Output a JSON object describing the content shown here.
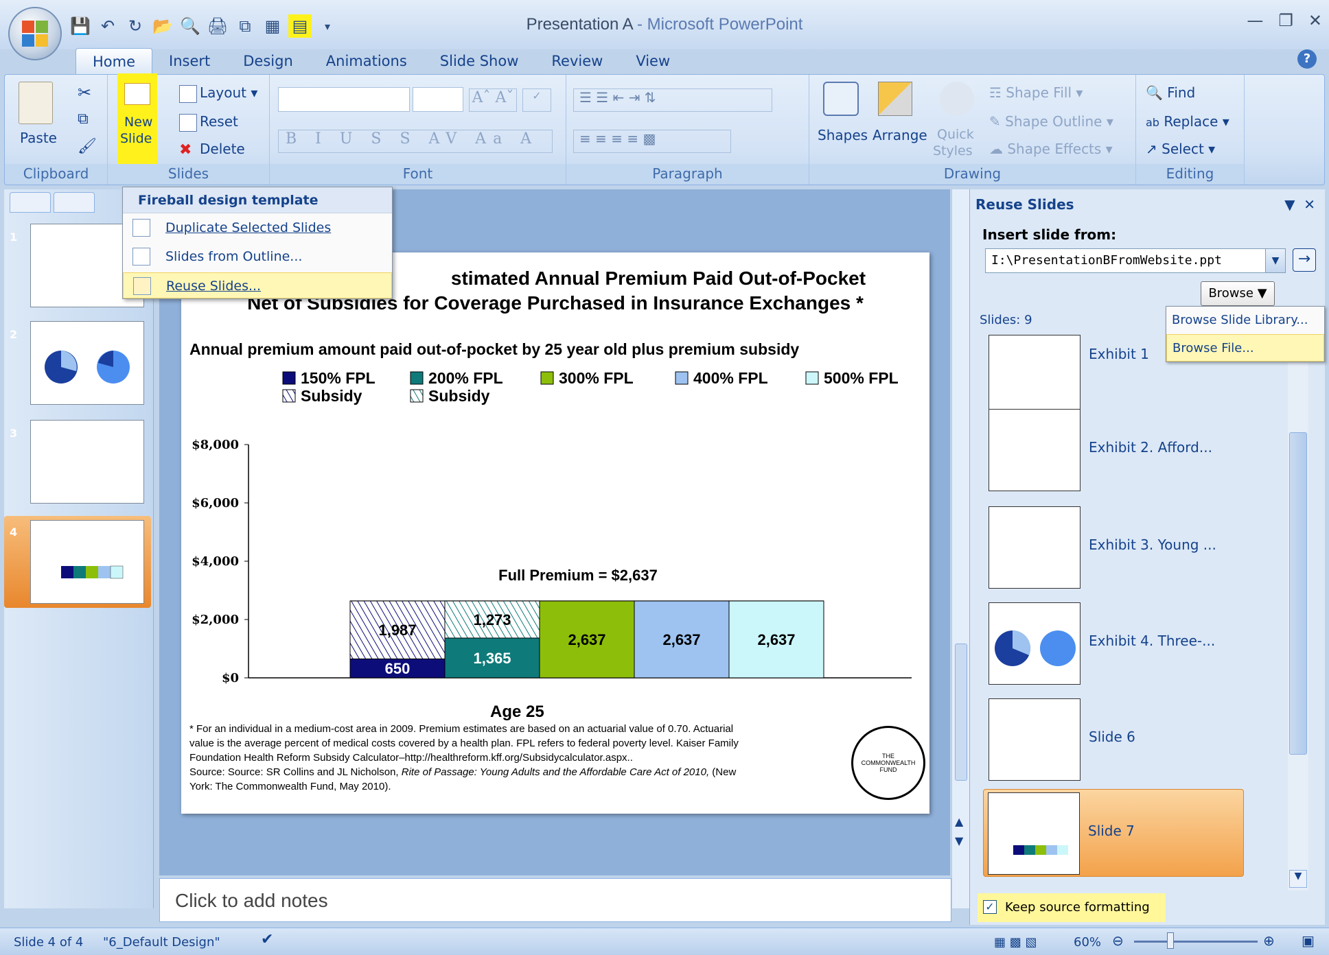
{
  "window": {
    "title": "Presentation A",
    "app": " - Microsoft PowerPoint"
  },
  "tabs": [
    "Home",
    "Insert",
    "Design",
    "Animations",
    "Slide Show",
    "Review",
    "View"
  ],
  "ribbon": {
    "clipboard": {
      "label": "Clipboard",
      "paste": "Paste"
    },
    "slides": {
      "label": "Slides",
      "new_slide_1": "New",
      "new_slide_2": "Slide",
      "layout": "Layout",
      "reset": "Reset",
      "delete": "Delete"
    },
    "font": {
      "label": "Font"
    },
    "paragraph": {
      "label": "Paragraph"
    },
    "drawing": {
      "label": "Drawing",
      "shapes": "Shapes",
      "arrange": "Arrange",
      "quick_styles_1": "Quick",
      "quick_styles_2": "Styles",
      "shape_fill": "Shape Fill",
      "shape_outline": "Shape Outline",
      "shape_effects": "Shape Effects"
    },
    "editing": {
      "label": "Editing",
      "find": "Find",
      "replace": "Replace",
      "select": "Select"
    }
  },
  "new_slide_menu": {
    "header": "Fireball design template",
    "items": [
      "Duplicate Selected Slides",
      "Slides from Outline...",
      "Reuse Slides..."
    ]
  },
  "slide_numbers": [
    "1",
    "2",
    "3",
    "4"
  ],
  "slide": {
    "title_line1": "stimated Annual Premium Paid Out-of-Pocket",
    "title_line2": "Net of Subsidies for Coverage Purchased in Insurance Exchanges",
    "title_star": " *",
    "subtitle": "Annual premium amount paid out-of-pocket by 25 year old plus premium subsidy",
    "full_premium": "Full Premium = $2,637",
    "footnote_1": "* For an individual in a medium-cost area in 2009. Premium estimates are based on an actuarial value of 0.70. Actuarial",
    "footnote_2": "value is the average percent of medical costs covered by a health plan. FPL refers to federal poverty level. Kaiser Family",
    "footnote_3": "Foundation Health Reform Subsidy Calculator–http://healthreform.kff.org/Subsidycalculator.aspx..",
    "footnote_4a": "Source: Source: SR Collins and JL Nicholson, ",
    "footnote_4b": "Rite of Passage: Young Adults and the Affordable Care Act of 2010,",
    "footnote_4c": " (New",
    "footnote_5": "York: The Commonwealth Fund, May 2010).",
    "logo_text": "THE COMMONWEALTH FUND"
  },
  "chart_data": {
    "type": "bar",
    "stacked": true,
    "title": "Annual premium amount paid out-of-pocket by 25 year old plus premium subsidy",
    "xlabel": "Age 25",
    "ylim": [
      0,
      8000
    ],
    "yticks": [
      "$0",
      "$2,000",
      "$4,000",
      "$6,000",
      "$8,000"
    ],
    "categories": [
      "150% FPL",
      "200% FPL",
      "300% FPL",
      "400% FPL",
      "500% FPL"
    ],
    "series": [
      {
        "name": "150% FPL",
        "values": [
          650,
          null,
          null,
          null,
          null
        ],
        "labels": [
          "650"
        ],
        "color": "#0d0d7a"
      },
      {
        "name": "Subsidy",
        "values": [
          1987,
          null,
          null,
          null,
          null
        ],
        "labels": [
          "1,987"
        ],
        "pattern": "hatch-blue"
      },
      {
        "name": "200% FPL",
        "values": [
          null,
          1365,
          null,
          null,
          null
        ],
        "labels": [
          "1,365"
        ],
        "color": "#0f7a7a"
      },
      {
        "name": "Subsidy",
        "values": [
          null,
          1273,
          null,
          null,
          null
        ],
        "labels": [
          "1,273"
        ],
        "pattern": "hatch-teal"
      },
      {
        "name": "300% FPL",
        "values": [
          null,
          null,
          2637,
          null,
          null
        ],
        "labels": [
          "2,637"
        ],
        "color": "#8dbf0a"
      },
      {
        "name": "400% FPL",
        "values": [
          null,
          null,
          null,
          2637,
          null
        ],
        "labels": [
          "2,637"
        ],
        "color": "#9ec3f0"
      },
      {
        "name": "500% FPL",
        "values": [
          null,
          null,
          null,
          null,
          2637
        ],
        "labels": [
          "2,637"
        ],
        "color": "#ccf7fa"
      }
    ],
    "legend": [
      "150% FPL",
      "200% FPL",
      "300% FPL",
      "400% FPL",
      "500% FPL",
      "Subsidy",
      "Subsidy"
    ],
    "annotation": "Full Premium = $2,637"
  },
  "notes_placeholder": "Click to add notes",
  "reuse_panel": {
    "title": "Reuse Slides",
    "insert_from": "Insert slide from:",
    "path": "I:\\PresentationBFromWebsite.ppt",
    "browse": "Browse",
    "slides_count": "Slides: 9",
    "browse_menu": [
      "Browse Slide Library...",
      "Browse File..."
    ],
    "items": [
      "Exhibit 1",
      "Exhibit 2. Afford...",
      "Exhibit 3. Young ...",
      "Exhibit 4. Three-...",
      "Slide 6",
      "Slide 7"
    ],
    "keep_source": "Keep source formatting"
  },
  "status": {
    "slide": "Slide 4 of 4",
    "theme": "\"6_Default Design\"",
    "zoom": "60%"
  },
  "colors": {
    "highlight": "#fff21c",
    "accent_orange": "#f6a14a",
    "ribbon_text": "#15428b"
  }
}
